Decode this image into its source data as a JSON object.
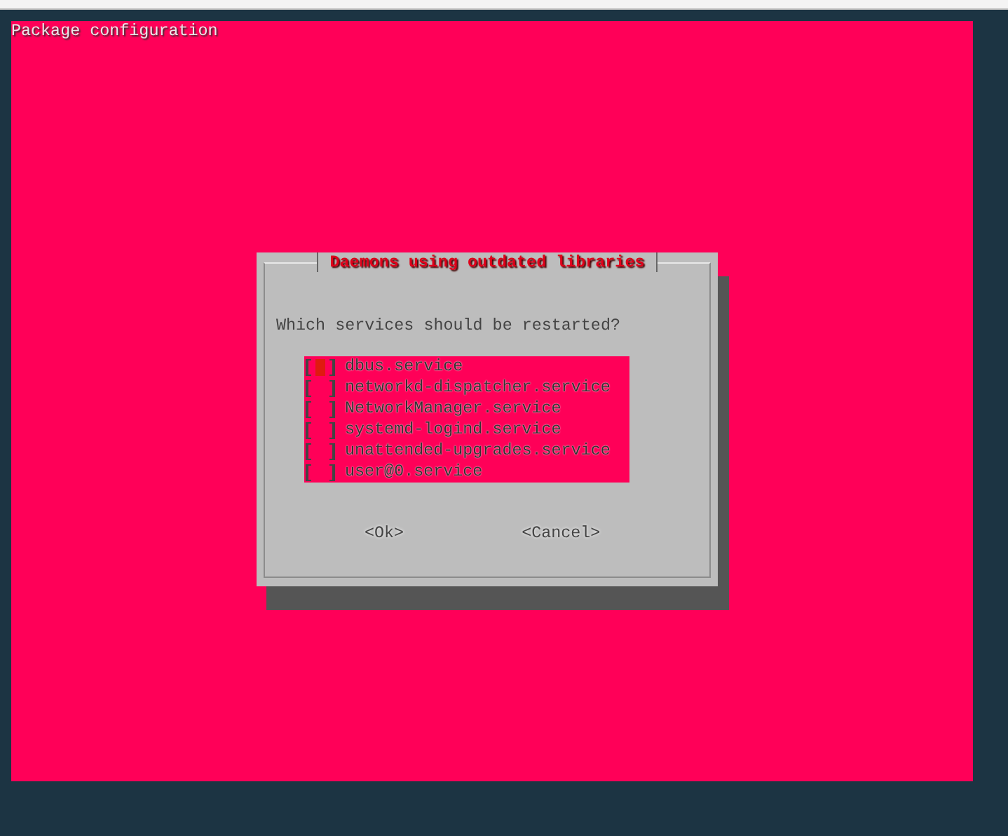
{
  "screen": {
    "title": "Package configuration"
  },
  "dialog": {
    "title": "Daemons using outdated libraries",
    "question": "Which services should be restarted?",
    "items": [
      {
        "label": "dbus.service",
        "checked": false,
        "selected": true
      },
      {
        "label": "networkd-dispatcher.service",
        "checked": false,
        "selected": false
      },
      {
        "label": "NetworkManager.service",
        "checked": false,
        "selected": false
      },
      {
        "label": "systemd-logind.service",
        "checked": false,
        "selected": false
      },
      {
        "label": "unattended-upgrades.service",
        "checked": false,
        "selected": false
      },
      {
        "label": "user@0.service",
        "checked": false,
        "selected": false
      }
    ],
    "buttons": [
      {
        "label": "<Ok>",
        "selected": false
      },
      {
        "label": "<Cancel>",
        "selected": false
      }
    ]
  }
}
